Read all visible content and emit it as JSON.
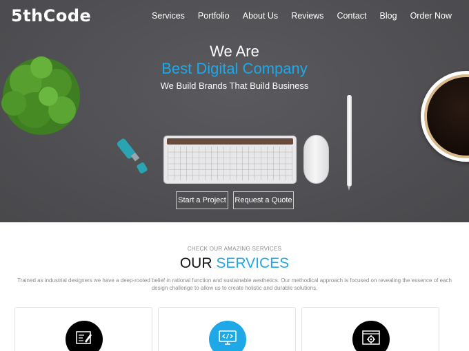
{
  "brand": {
    "logo_text": "5thCode"
  },
  "nav": {
    "items": [
      {
        "label": "Services"
      },
      {
        "label": "Portfolio"
      },
      {
        "label": "About Us"
      },
      {
        "label": "Reviews"
      },
      {
        "label": "Contact"
      },
      {
        "label": "Blog"
      },
      {
        "label": "Order Now"
      }
    ]
  },
  "hero": {
    "line1": "We Are",
    "line2": "Best Digital Company",
    "tagline": "We Build Brands That Build Business",
    "primary_button": "Start a Project",
    "secondary_button": "Request a Quote",
    "colors": {
      "background": "#555559",
      "accent": "#1ea8e8"
    }
  },
  "services": {
    "kicker": "CHECK OUR AMAZING SERVICES",
    "title_plain": "OUR",
    "title_accent": "SERVICES",
    "description": "Trained as industrial designers we have a deep-rooted belief in rational function and sustainable aesthetics. Our methodical approach is focused on revealing the essence of each design challenge to allow us to create holistic and durable solutions.",
    "cards": [
      {
        "icon": "design-edit-icon",
        "color": "#000000"
      },
      {
        "icon": "code-monitor-icon",
        "color": "#1ea8e8"
      },
      {
        "icon": "settings-gear-icon",
        "color": "#000000"
      }
    ]
  }
}
